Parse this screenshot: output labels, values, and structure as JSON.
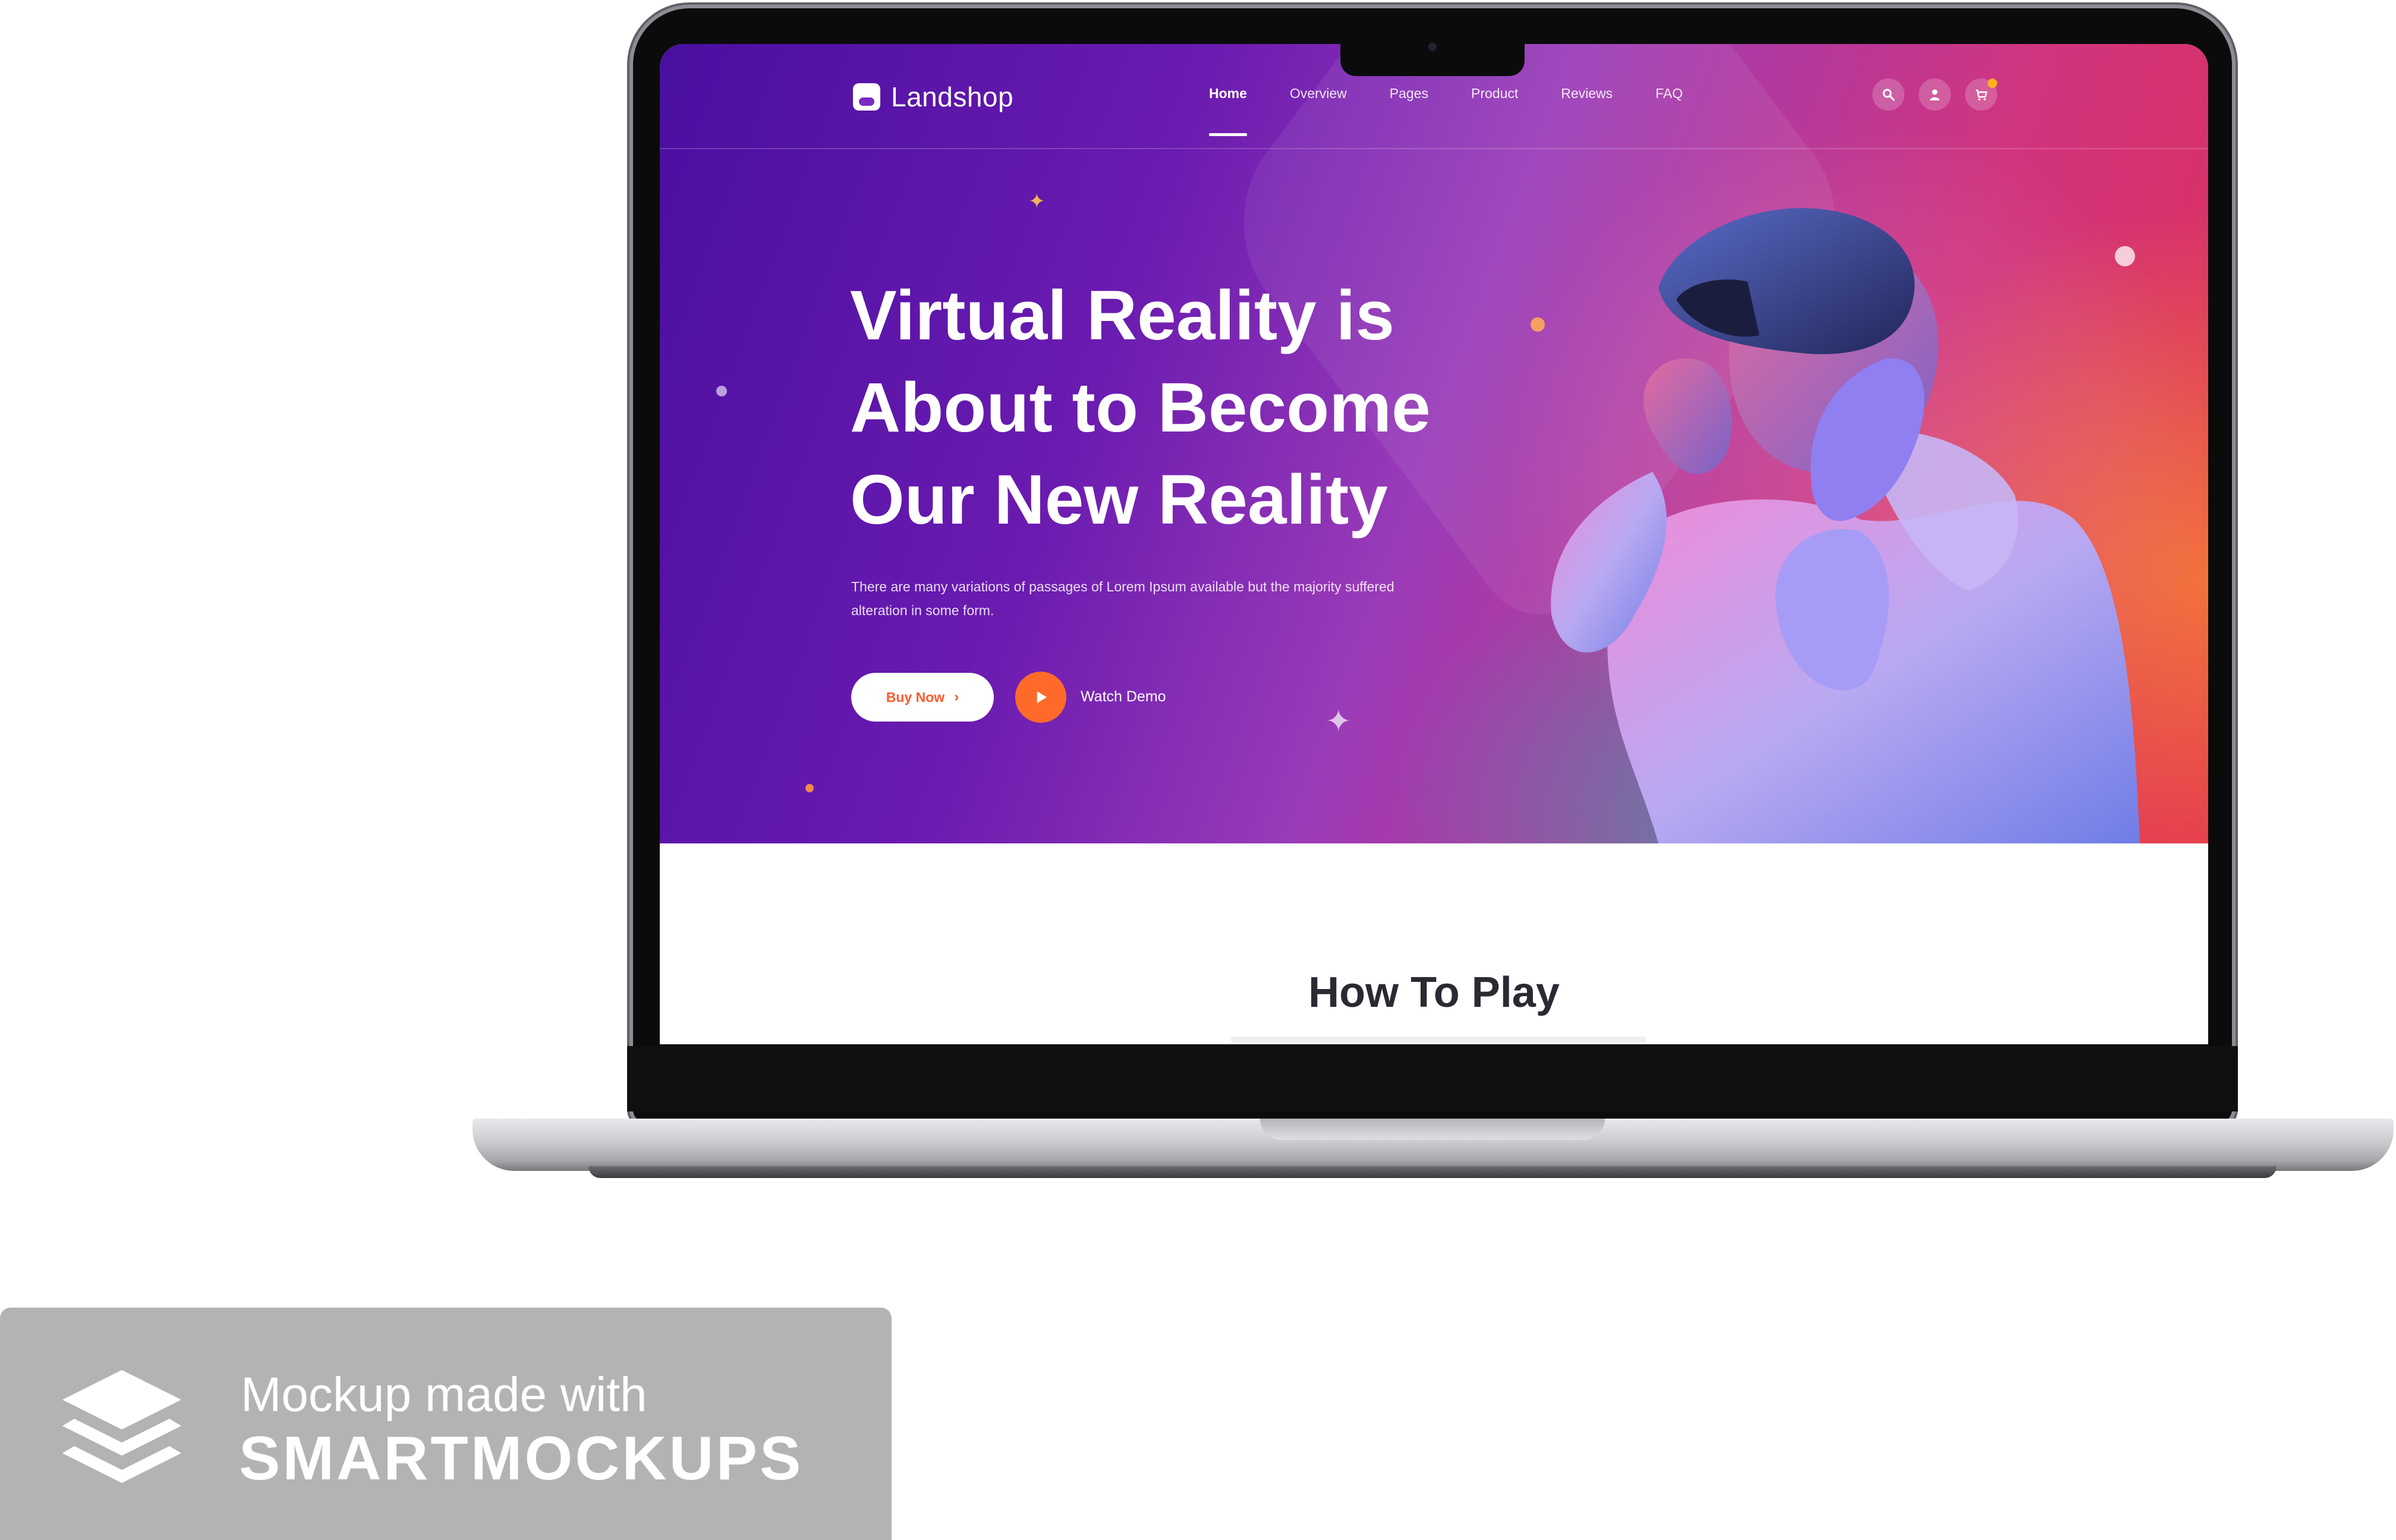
{
  "site": {
    "brand": "Landshop",
    "nav": [
      {
        "label": "Home",
        "active": true
      },
      {
        "label": "Overview",
        "active": false
      },
      {
        "label": "Pages",
        "active": false
      },
      {
        "label": "Product",
        "active": false
      },
      {
        "label": "Reviews",
        "active": false
      },
      {
        "label": "FAQ",
        "active": false
      }
    ],
    "header_icons": [
      "search-icon",
      "user-icon",
      "cart-icon"
    ],
    "hero": {
      "title_lines": [
        "Virtual Reality is",
        "About to Become",
        "Our New Reality"
      ],
      "subtitle": "There are many variations of passages of Lorem Ipsum available but the majority suffered alteration in some form.",
      "buy_label": "Buy Now",
      "watch_label": "Watch Demo"
    },
    "section_title": "How To Play"
  },
  "watermark": {
    "line1": "Mockup made with",
    "line2": "SMARTMOCKUPS"
  },
  "colors": {
    "accent": "#ff6a2b",
    "hero_start": "#4a0fa0",
    "hero_end": "#e02c55",
    "watermark_bg": "#b3b3b3"
  }
}
